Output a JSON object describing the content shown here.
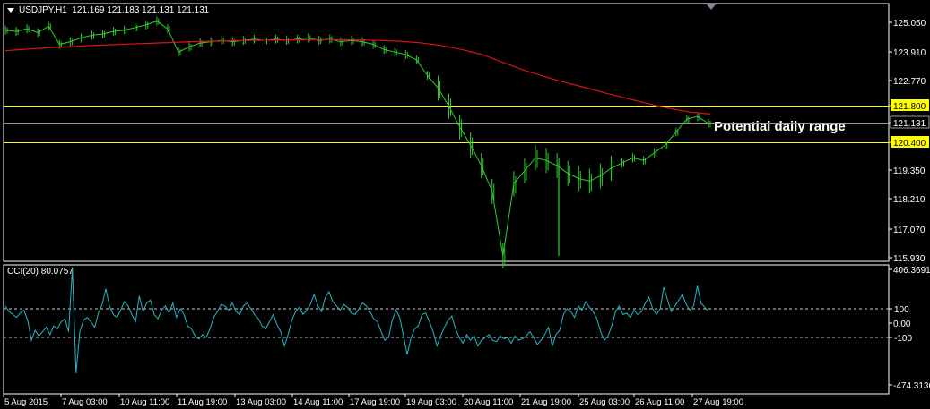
{
  "header": {
    "symbol": "USDJPY,H1",
    "ohlc": "121.169 121.183 121.131 121.131"
  },
  "indicator": {
    "label": "CCI(20) 80.0757"
  },
  "annotation": "Potential daily range",
  "colors": {
    "background": "#000000",
    "price": "#33cc33",
    "ma": "#e01010",
    "level": "#ffff00",
    "cci": "#29b6c4",
    "axis": "#ffffff"
  },
  "chart_data": [
    {
      "type": "line",
      "title": "USDJPY,H1",
      "x_tick_labels": [
        "5 Aug 2015",
        "7 Aug 03:00",
        "10 Aug 11:00",
        "11 Aug 19:00",
        "13 Aug 03:00",
        "14 Aug 11:00",
        "17 Aug 19:00",
        "19 Aug 03:00",
        "20 Aug 11:00",
        "21 Aug 19:00",
        "25 Aug 03:00",
        "26 Aug 11:00",
        "27 Aug 19:00"
      ],
      "y_ticks": [
        125.05,
        123.91,
        122.77,
        121.8,
        121.131,
        120.4,
        119.35,
        118.21,
        117.07,
        115.93
      ],
      "y_tick_labels": [
        "125.050",
        "123.910",
        "122.770",
        "121.800",
        "121.131",
        "120.400",
        "119.350",
        "118.210",
        "117.070",
        "115.930"
      ],
      "ylim": [
        115.93,
        125.5
      ],
      "series": [
        {
          "type": "ohlc_bars",
          "values": [
            124.75,
            124.7,
            124.8,
            124.65,
            124.9,
            124.2,
            124.3,
            124.45,
            124.55,
            124.6,
            124.7,
            124.75,
            124.85,
            124.95,
            125.1,
            124.8,
            123.9,
            124.1,
            124.25,
            124.3,
            124.35,
            124.3,
            124.35,
            124.4,
            124.35,
            124.4,
            124.35,
            124.4,
            124.45,
            124.35,
            124.4,
            124.3,
            124.35,
            124.3,
            124.2,
            124.0,
            123.9,
            123.8,
            123.6,
            123.0,
            122.5,
            121.8,
            121.0,
            120.3,
            119.5,
            118.5,
            116.0,
            118.8,
            119.3,
            119.8,
            119.7,
            119.5,
            119.2,
            119.0,
            118.9,
            119.1,
            119.4,
            119.6,
            119.8,
            119.7,
            120.0,
            120.3,
            120.8,
            121.3,
            121.4,
            121.131
          ]
        },
        {
          "name": "Moving Average",
          "type": "line",
          "values": [
            123.95,
            124.01,
            124.06,
            124.1,
            124.15,
            124.18,
            124.21,
            124.24,
            124.27,
            124.3,
            124.32,
            124.34,
            124.35,
            124.36,
            124.37,
            124.38,
            124.38,
            124.37,
            124.35,
            124.32,
            124.26,
            124.16,
            124.0,
            123.8,
            123.5,
            123.2,
            122.95,
            122.72,
            122.52,
            122.3,
            122.1,
            121.9,
            121.72,
            121.58,
            121.5
          ]
        }
      ],
      "levels": [
        {
          "value": 121.8,
          "label": "121.800"
        },
        {
          "value": 120.4,
          "label": "120.400"
        },
        {
          "value": 121.131,
          "label": "121.131"
        }
      ]
    },
    {
      "type": "line",
      "title": "CCI(20) 80.0757",
      "y_ticks": [
        406.3691,
        100,
        0,
        -100,
        -474.3136
      ],
      "y_tick_labels": [
        "406.3691",
        "100",
        "0.00",
        "-100",
        "-474.3136"
      ],
      "ylim": [
        -474.3136,
        406.3691
      ],
      "reference_lines": [
        100,
        -100
      ],
      "series": [
        {
          "name": "CCI(20)",
          "values": [
            120,
            80,
            60,
            40,
            70,
            90,
            20,
            -120,
            -50,
            -90,
            -60,
            -30,
            -80,
            -20,
            -40,
            10,
            30,
            -60,
            380,
            -350,
            -60,
            20,
            40,
            10,
            -30,
            70,
            130,
            240,
            120,
            60,
            40,
            90,
            150,
            120,
            60,
            10,
            190,
            80,
            140,
            160,
            60,
            30,
            90,
            120,
            70,
            140,
            40,
            100,
            60,
            -20,
            -40,
            -90,
            -110,
            -80,
            -100,
            -40,
            40,
            80,
            130,
            120,
            90,
            140,
            80,
            60,
            120,
            140,
            100,
            60,
            30,
            -20,
            -40,
            10,
            60,
            -10,
            -60,
            -160,
            -80,
            20,
            80,
            110,
            60,
            90,
            130,
            200,
            120,
            80,
            180,
            220,
            150,
            120,
            90,
            130,
            110,
            70,
            60,
            100,
            140,
            120,
            80,
            30,
            10,
            -60,
            -120,
            -100,
            20,
            90,
            40,
            -90,
            -220,
            -110,
            -40,
            -20,
            60,
            70,
            10,
            -60,
            -160,
            -90,
            -30,
            20,
            50,
            -40,
            -100,
            -140,
            -80,
            -120,
            -90,
            -160,
            -120,
            -100,
            -80,
            -120,
            -130,
            -90,
            -110,
            -100,
            -140,
            -90,
            -120,
            -110,
            -90,
            -60,
            -100,
            -150,
            -120,
            -80,
            -30,
            -160,
            -80,
            -50,
            60,
            100,
            80,
            40,
            120,
            90,
            150,
            110,
            80,
            30,
            -60,
            -120,
            -90,
            -20,
            80,
            120,
            60,
            70,
            40,
            90,
            60,
            80,
            140,
            180,
            100,
            60,
            100,
            250,
            160,
            80,
            120,
            160,
            200,
            130,
            90,
            120,
            260,
            140,
            110,
            80.0757
          ]
        }
      ]
    }
  ]
}
